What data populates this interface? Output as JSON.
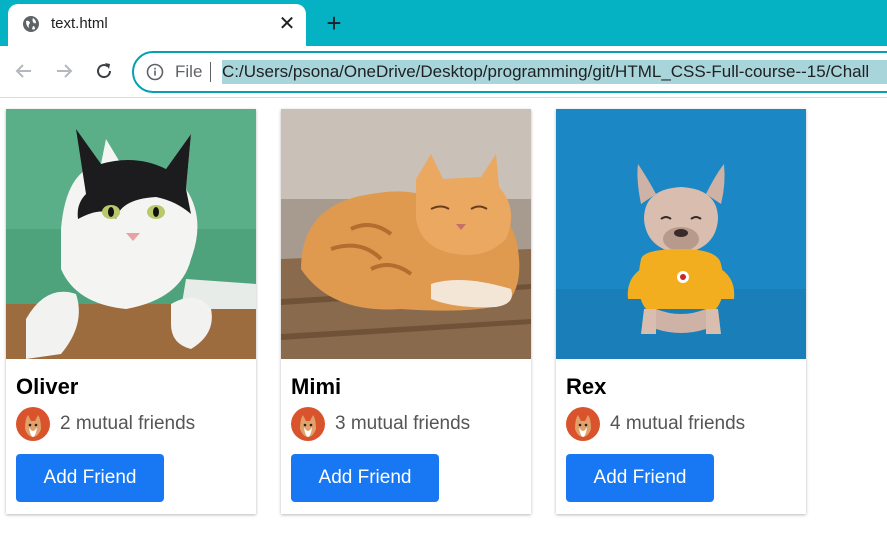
{
  "tab": {
    "title": "text.html"
  },
  "omnibox": {
    "scheme_label": "File",
    "url": "C:/Users/psona/OneDrive/Desktop/programming/git/HTML_CSS-Full-course--15/Chall"
  },
  "colors": {
    "tabstrip": "#05b2c3",
    "button": "#1877f2",
    "url_highlight": "#a8d5da"
  },
  "cards": [
    {
      "name": "Oliver",
      "mutual": "2 mutual friends",
      "button": "Add Friend",
      "photo_icon": "cat-photo"
    },
    {
      "name": "Mimi",
      "mutual": "3 mutual friends",
      "button": "Add Friend",
      "photo_icon": "cat-photo"
    },
    {
      "name": "Rex",
      "mutual": "4 mutual friends",
      "button": "Add Friend",
      "photo_icon": "dog-photo"
    }
  ]
}
